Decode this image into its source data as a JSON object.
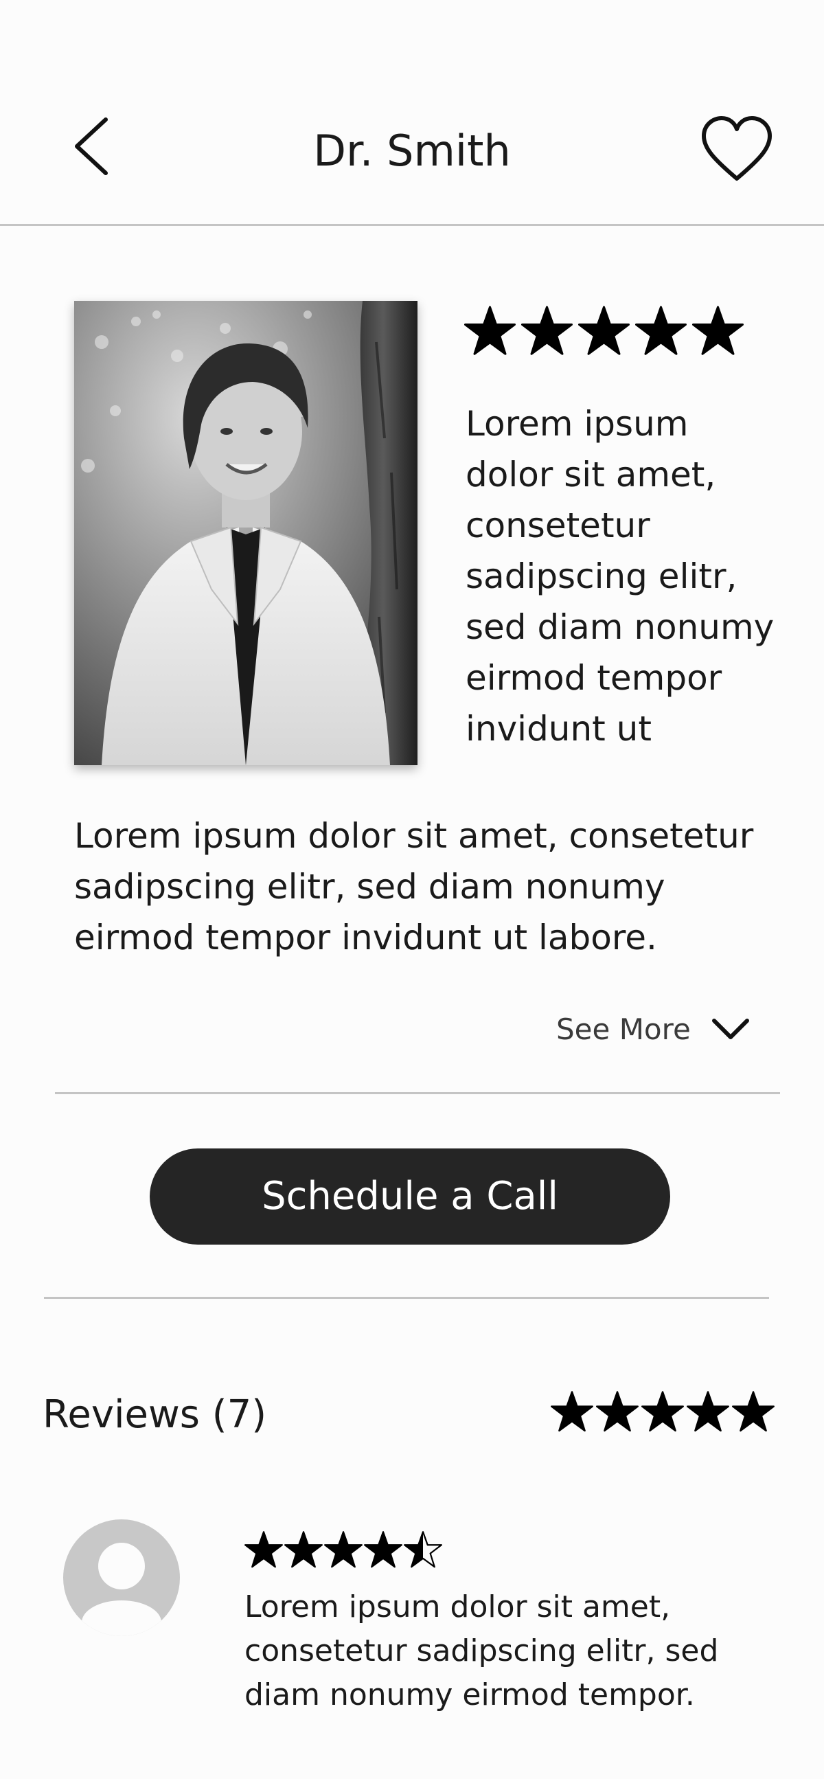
{
  "header": {
    "title": "Dr. Smith",
    "back_icon": "chevron-left-icon",
    "favorite_icon": "heart-outline-icon"
  },
  "profile": {
    "rating_stars": 5,
    "short_bio": "Lorem ipsum dolor sit amet, consetetur sadipscing elitr, sed diam nonumy eirmod tempor invidunt ut",
    "bio": "Lorem ipsum dolor sit amet, consetetur sadipscing elitr, sed diam nonumy eirmod tempor invidunt ut labore.",
    "see_more_label": "See More",
    "see_more_icon": "chevron-down-icon"
  },
  "actions": {
    "schedule_label": "Schedule a Call"
  },
  "reviews": {
    "title": "Reviews (7)",
    "average_stars": 5,
    "items": [
      {
        "avatar_icon": "user-avatar-icon",
        "stars": 4.5,
        "text": "Lorem ipsum dolor sit amet, consetetur sadipscing elitr, sed diam nonumy eirmod tempor."
      }
    ]
  },
  "colors": {
    "background": "#fcfcfc",
    "button": "#252525",
    "divider": "#c4c4c4",
    "avatar": "#c8c8c8"
  }
}
